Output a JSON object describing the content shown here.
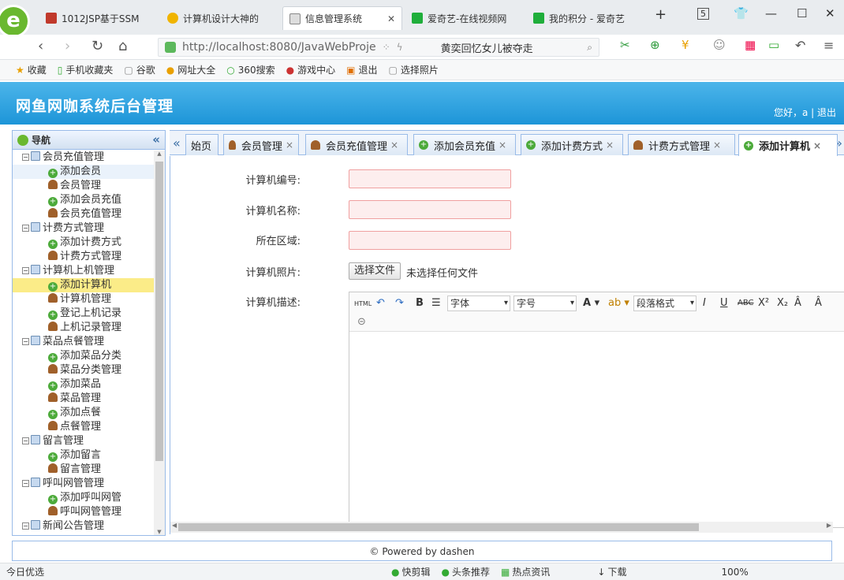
{
  "browser": {
    "tabs": [
      {
        "label": "1012JSP基于SSM",
        "color": "#c0392b"
      },
      {
        "label": "计算机设计大神的",
        "color": "#f0b400"
      },
      {
        "label": "信息管理系统",
        "color": "#888888",
        "active": true
      },
      {
        "label": "爱奇艺-在线视频网",
        "color": "#1fae3b"
      },
      {
        "label": "我的积分 - 爱奇艺",
        "color": "#1fae3b"
      }
    ],
    "tab_count": "5",
    "url": "http://localhost:8080/JavaWebProje",
    "search_hint": "黄奕回忆女儿被夺走",
    "bookmarks": [
      "收藏",
      "手机收藏夹",
      "谷歌",
      "网址大全",
      "360搜索",
      "游戏中心",
      "退出",
      "选择照片"
    ],
    "zoom": "100%"
  },
  "app": {
    "title": "网鱼网咖系统后台管理",
    "greeting": "您好，a | 退出",
    "nav_title": "导航",
    "footer": "© Powered by dashen"
  },
  "tree": [
    {
      "label": "会员充值管理",
      "type": "folder"
    },
    {
      "label": "添加会员",
      "type": "plus",
      "state": "hover"
    },
    {
      "label": "会员管理",
      "type": "person"
    },
    {
      "label": "添加会员充值",
      "type": "plus"
    },
    {
      "label": "会员充值管理",
      "type": "person"
    },
    {
      "label": "计费方式管理",
      "type": "folder"
    },
    {
      "label": "添加计费方式",
      "type": "plus"
    },
    {
      "label": "计费方式管理",
      "type": "person"
    },
    {
      "label": "计算机上机管理",
      "type": "folder"
    },
    {
      "label": "添加计算机",
      "type": "plus",
      "state": "selected"
    },
    {
      "label": "计算机管理",
      "type": "person"
    },
    {
      "label": "登记上机记录",
      "type": "plus"
    },
    {
      "label": "上机记录管理",
      "type": "person"
    },
    {
      "label": "菜品点餐管理",
      "type": "folder"
    },
    {
      "label": "添加菜品分类",
      "type": "plus"
    },
    {
      "label": "菜品分类管理",
      "type": "person"
    },
    {
      "label": "添加菜品",
      "type": "plus"
    },
    {
      "label": "菜品管理",
      "type": "person"
    },
    {
      "label": "添加点餐",
      "type": "plus"
    },
    {
      "label": "点餐管理",
      "type": "person"
    },
    {
      "label": "留言管理",
      "type": "folder"
    },
    {
      "label": "添加留言",
      "type": "plus"
    },
    {
      "label": "留言管理",
      "type": "person"
    },
    {
      "label": "呼叫网管管理",
      "type": "folder"
    },
    {
      "label": "添加呼叫网管",
      "type": "plus"
    },
    {
      "label": "呼叫网管管理",
      "type": "person"
    },
    {
      "label": "新闻公告管理",
      "type": "folder"
    }
  ],
  "content_tabs": [
    {
      "label": "始页",
      "icon": "none"
    },
    {
      "label": "会员管理",
      "icon": "person"
    },
    {
      "label": "会员充值管理",
      "icon": "person"
    },
    {
      "label": "添加会员充值",
      "icon": "plus"
    },
    {
      "label": "添加计费方式",
      "icon": "plus"
    },
    {
      "label": "计费方式管理",
      "icon": "person"
    },
    {
      "label": "添加计算机",
      "icon": "plus",
      "active": true
    }
  ],
  "form": {
    "computer_no": "计算机编号:",
    "computer_name": "计算机名称:",
    "area": "所在区域:",
    "photo": "计算机照片:",
    "choose_file": "选择文件",
    "no_file": "未选择任何文件",
    "description": "计算机描述:"
  },
  "editor": {
    "font": "字体",
    "size": "字号",
    "para": "段落格式"
  },
  "statusbar": {
    "left": "今日优选",
    "items": [
      "快剪辑",
      "头条推荐",
      "热点资讯",
      "下载"
    ]
  }
}
